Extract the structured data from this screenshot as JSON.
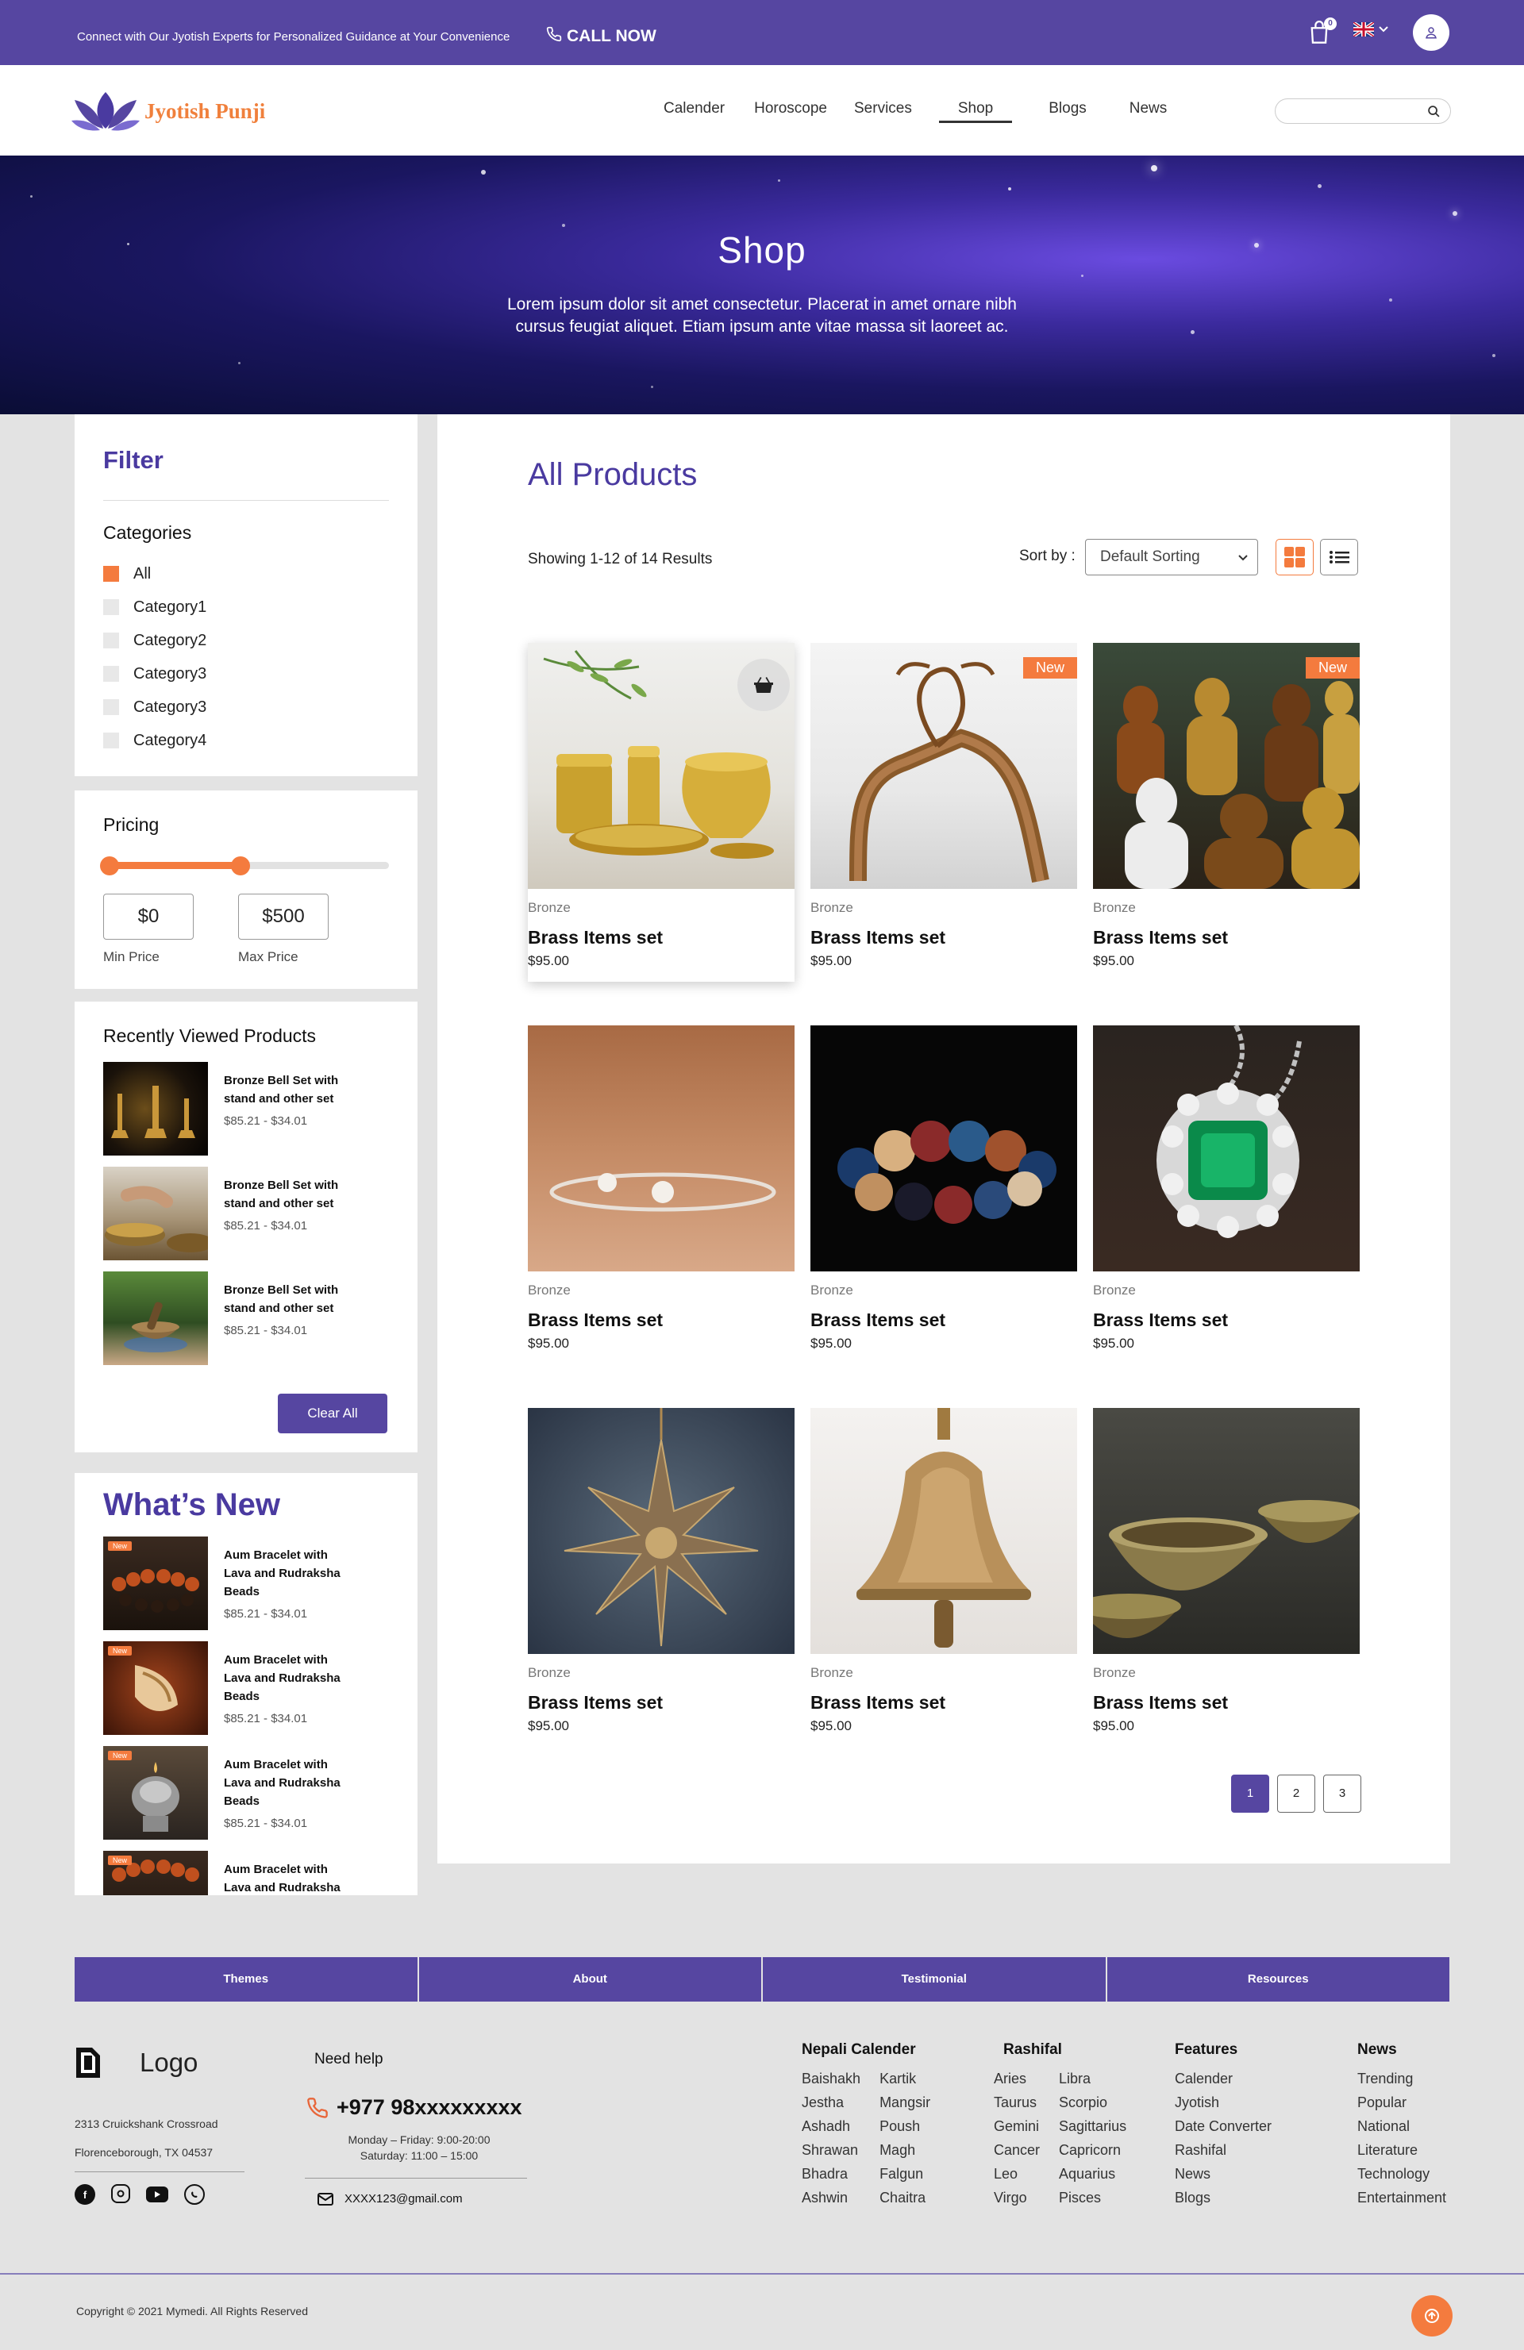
{
  "topbar": {
    "promo": "Connect with Our Jyotish Experts for Personalized Guidance at Your Convenience",
    "call_label": "CALL NOW",
    "cart_count": "0"
  },
  "brand": {
    "name": "Jyotish Punji"
  },
  "nav": {
    "items": [
      "Calender",
      "Horoscope",
      "Services",
      "Shop",
      "Blogs",
      "News"
    ],
    "active": "Shop",
    "search_placeholder": ""
  },
  "hero": {
    "title": "Shop",
    "subtitle": "Lorem ipsum dolor sit amet consectetur. Placerat in amet ornare nibh cursus feugiat aliquet. Etiam ipsum ante vitae massa sit laoreet ac."
  },
  "filter": {
    "title": "Filter",
    "categories_title": "Categories",
    "categories": [
      {
        "label": "All",
        "checked": true
      },
      {
        "label": "Category1",
        "checked": false
      },
      {
        "label": "Category2",
        "checked": false
      },
      {
        "label": "Category3",
        "checked": false
      },
      {
        "label": "Category3",
        "checked": false
      },
      {
        "label": "Category4",
        "checked": false
      }
    ]
  },
  "pricing": {
    "title": "Pricing",
    "min_value": "$0",
    "max_value": "$500",
    "min_label": "Min Price",
    "max_label": "Max Price",
    "range_fraction": [
      0.0,
      0.48
    ]
  },
  "recent": {
    "title": "Recently Viewed Products",
    "items": [
      {
        "name": "Bronze Bell Set with stand and other set",
        "price": "$85.21 - $34.01"
      },
      {
        "name": "Bronze Bell Set with stand and other set",
        "price": "$85.21 - $34.01"
      },
      {
        "name": "Bronze Bell Set with stand and other set",
        "price": "$85.21 - $34.01"
      }
    ],
    "clear_label": "Clear All"
  },
  "whats_new": {
    "title": "What’s New",
    "tag": "New",
    "items": [
      {
        "name": "Aum Bracelet with Lava and Rudraksha Beads",
        "price": "$85.21 - $34.01"
      },
      {
        "name": "Aum Bracelet with Lava and Rudraksha Beads",
        "price": "$85.21 - $34.01"
      },
      {
        "name": "Aum Bracelet with Lava and Rudraksha Beads",
        "price": "$85.21 - $34.01"
      },
      {
        "name": "Aum Bracelet with Lava and Rudraksha Beads",
        "price": ""
      }
    ]
  },
  "products": {
    "title": "All Products",
    "results_text": "Showing 1-12 of 14 Results",
    "sort_label": "Sort by :",
    "sort_value": "Default Sorting",
    "new_badge": "New",
    "items": [
      {
        "category": "Bronze",
        "name": "Brass Items set",
        "price": "$95.00",
        "image": "brass-vessels"
      },
      {
        "category": "Bronze",
        "name": "Brass Items set",
        "price": "$95.00",
        "image": "copper-tool",
        "is_new": true
      },
      {
        "category": "Bronze",
        "name": "Brass Items set",
        "price": "$95.00",
        "image": "buddha-statues",
        "is_new": true
      },
      {
        "category": "Bronze",
        "name": "Brass Items set",
        "price": "$95.00",
        "image": "silver-bracelet"
      },
      {
        "category": "Bronze",
        "name": "Brass Items set",
        "price": "$95.00",
        "image": "bead-bracelet"
      },
      {
        "category": "Bronze",
        "name": "Brass Items set",
        "price": "$95.00",
        "image": "emerald-pendant"
      },
      {
        "category": "Bronze",
        "name": "Brass Items set",
        "price": "$95.00",
        "image": "star-ornament"
      },
      {
        "category": "Bronze",
        "name": "Brass Items set",
        "price": "$95.00",
        "image": "brass-bell"
      },
      {
        "category": "Bronze",
        "name": "Brass Items set",
        "price": "$95.00",
        "image": "singing-bowls"
      }
    ],
    "pages": [
      "1",
      "2",
      "3"
    ]
  },
  "footer": {
    "tabs": [
      "Themes",
      "About",
      "Testimonial",
      "Resources"
    ],
    "logo_word": "Logo",
    "address_line1": "2313 Cruickshank Crossroad",
    "address_line2": "Florenceborough, TX 04537",
    "need_help": "Need help",
    "phone": "+977 98xxxxxxxxx",
    "hours_line1": "Monday – Friday: 9:00-20:00",
    "hours_line2": "Saturday: 11:00 – 15:00",
    "email": "XXXX123@gmail.com",
    "nepali_calendar": {
      "title": "Nepali Calender",
      "col1": [
        "Baishakh",
        "Jestha",
        "Ashadh",
        "Shrawan",
        "Bhadra",
        "Ashwin"
      ],
      "col2": [
        "Kartik",
        "Mangsir",
        "Poush",
        "Magh",
        "Falgun",
        "Chaitra"
      ]
    },
    "rashifal": {
      "title": "Rashifal",
      "col1": [
        "Aries",
        "Taurus",
        "Gemini",
        "Cancer",
        "Leo",
        "Virgo"
      ],
      "col2": [
        "Libra",
        "Scorpio",
        "Sagittarius",
        "Capricorn",
        "Aquarius",
        "Pisces"
      ]
    },
    "features": {
      "title": "Features",
      "items": [
        "Calender",
        "Jyotish",
        "Date Converter",
        "Rashifal",
        "News",
        "Blogs"
      ]
    },
    "news": {
      "title": "News",
      "items": [
        "Trending",
        "Popular",
        "National",
        "Literature",
        "Technology",
        "Entertainment"
      ]
    },
    "copyright": "Copyright © 2021 Mymedi. All Rights Reserved"
  },
  "colors": {
    "primary": "#5646a1",
    "accent": "#f47b3e",
    "heading": "#4a3aa0"
  }
}
